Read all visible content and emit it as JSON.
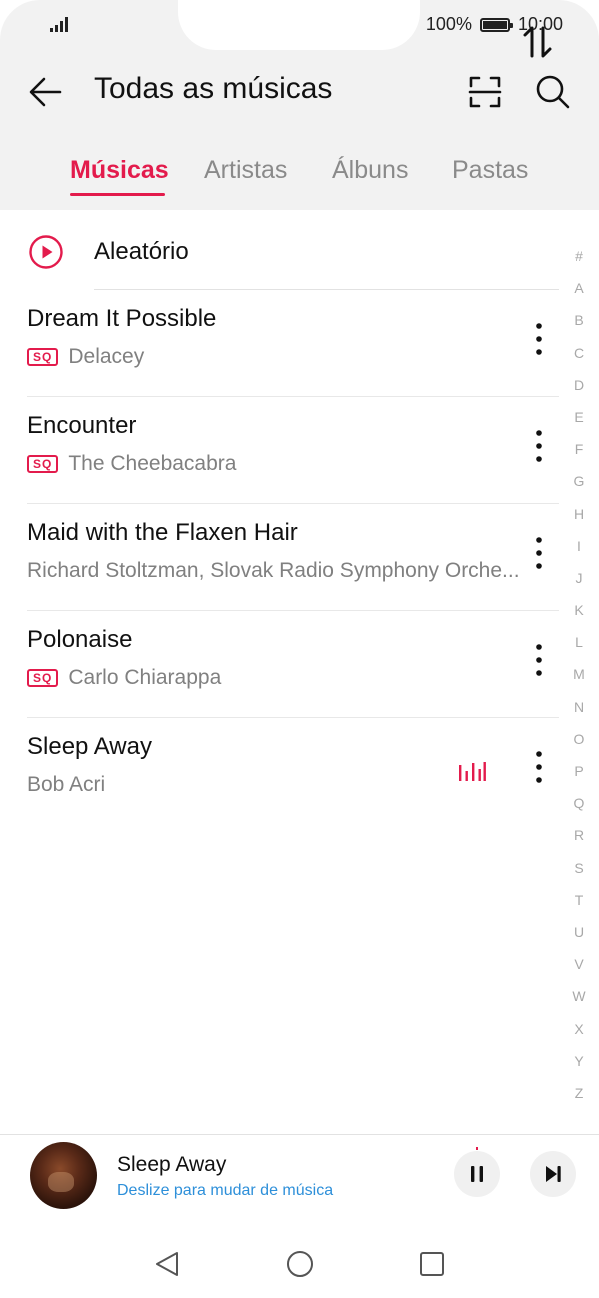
{
  "status_bar": {
    "battery_text": "100%",
    "time": "10:00"
  },
  "header": {
    "title": "Todas as músicas",
    "icons": [
      "back-arrow-icon",
      "scan-icon",
      "search-icon"
    ]
  },
  "tabs": [
    {
      "label": "Músicas",
      "active": true
    },
    {
      "label": "Artistas",
      "active": false
    },
    {
      "label": "Álbuns",
      "active": false
    },
    {
      "label": "Pastas",
      "active": false
    }
  ],
  "shuffle": {
    "label": "Aleatório"
  },
  "songs": [
    {
      "title": "Dream It Possible",
      "artist": "Delacey",
      "sq": true,
      "playing": false
    },
    {
      "title": "Encounter",
      "artist": "The Cheebacabra",
      "sq": true,
      "playing": false
    },
    {
      "title": "Maid with the Flaxen Hair",
      "artist": "Richard Stoltzman, Slovak Radio Symphony Orche...",
      "sq": false,
      "playing": false
    },
    {
      "title": "Polonaise",
      "artist": "Carlo Chiarappa",
      "sq": true,
      "playing": false
    },
    {
      "title": "Sleep Away",
      "artist": "Bob Acri",
      "sq": false,
      "playing": true
    }
  ],
  "sq_badge": "SQ",
  "alpha_index": [
    "#",
    "A",
    "B",
    "C",
    "D",
    "E",
    "F",
    "G",
    "H",
    "I",
    "J",
    "K",
    "L",
    "M",
    "N",
    "O",
    "P",
    "Q",
    "R",
    "S",
    "T",
    "U",
    "V",
    "W",
    "X",
    "Y",
    "Z"
  ],
  "player": {
    "title": "Sleep Away",
    "hint": "Deslize para mudar de música"
  },
  "colors": {
    "accent": "#e31b4c",
    "hint_blue": "#2d8fd9"
  }
}
